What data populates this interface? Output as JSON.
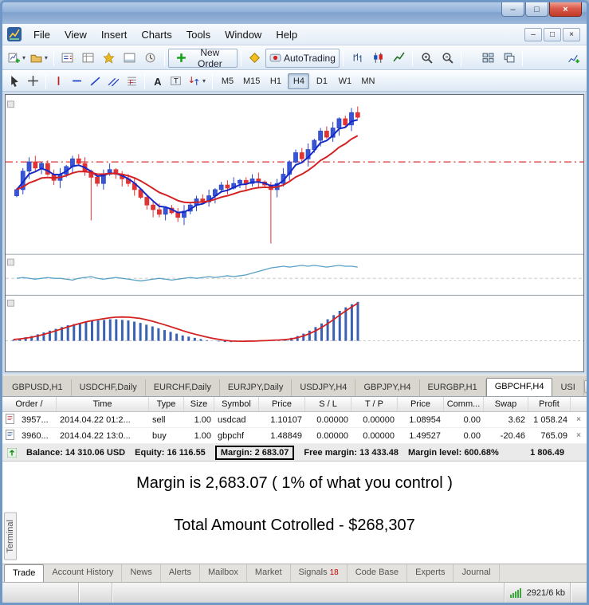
{
  "window": {
    "title": ""
  },
  "menu": {
    "items": [
      "File",
      "View",
      "Insert",
      "Charts",
      "Tools",
      "Window",
      "Help"
    ]
  },
  "toolbar": {
    "new_order_label": "New Order",
    "autotrading_label": "AutoTrading",
    "row1_groups": [
      [
        "new-chart",
        "profiles"
      ],
      [
        "market-watch",
        "data-window",
        "navigator",
        "terminal-panel",
        "strategy-tester"
      ],
      [
        "new-order"
      ],
      [
        "metaeditor",
        "autotrading"
      ],
      [
        "bar-chart",
        "candlestick-chart",
        "line-chart"
      ],
      [
        "zoom-in",
        "zoom-out"
      ],
      [
        "arrange-windows",
        "cascade-windows"
      ],
      [
        "indicators"
      ]
    ],
    "row2_groups": [
      [
        "cursor",
        "crosshair"
      ],
      [
        "vertical-line",
        "horizontal-line",
        "trendline",
        "channel",
        "fibonacci"
      ],
      [
        "text",
        "label",
        "shapes"
      ]
    ]
  },
  "timeframes": {
    "items": [
      "M5",
      "M15",
      "H1",
      "H4",
      "D1",
      "W1",
      "MN"
    ],
    "active": "H4"
  },
  "chart_tabs": {
    "items": [
      "GBPUSD,H1",
      "USDCHF,Daily",
      "EURCHF,Daily",
      "EURJPY,Daily",
      "USDJPY,H4",
      "GBPJPY,H4",
      "EURGBP,H1",
      "GBPCHF,H4",
      "USI"
    ],
    "active": "GBPCHF,H4"
  },
  "terminal": {
    "columns": [
      "Order /",
      "Time",
      "Type",
      "Size",
      "Symbol",
      "Price",
      "S / L",
      "T / P",
      "Price",
      "Comm...",
      "Swap",
      "Profit"
    ],
    "orders": [
      {
        "order": "3957...",
        "time": "2014.04.22 01:2...",
        "type": "sell",
        "size": "1.00",
        "symbol": "usdcad",
        "price": "1.10107",
        "sl": "0.00000",
        "tp": "0.00000",
        "price2": "1.08954",
        "commission": "0.00",
        "swap": "3.62",
        "profit": "1 058.24"
      },
      {
        "order": "3960...",
        "time": "2014.04.22 13:0...",
        "type": "buy",
        "size": "1.00",
        "symbol": "gbpchf",
        "price": "1.48849",
        "sl": "0.00000",
        "tp": "0.00000",
        "price2": "1.49527",
        "commission": "0.00",
        "swap": "-20.46",
        "profit": "765.09"
      }
    ],
    "balance_row": {
      "balance": "Balance: 14 310.06 USD",
      "equity": "Equity: 16 116.55",
      "margin": "Margin: 2 683.07",
      "free_margin": "Free margin: 13 433.48",
      "margin_level": "Margin level: 600.68%",
      "total_profit": "1 806.49"
    },
    "vertical_label": "Terminal"
  },
  "annotations": {
    "line1": "Margin is 2,683.07   ( 1% of what you control )",
    "line2": "Total Amount Cotrolled - $268,307"
  },
  "bottom_tabs": {
    "items": [
      "Trade",
      "Account History",
      "News",
      "Alerts",
      "Mailbox",
      "Market",
      "Signals",
      "Code Base",
      "Experts",
      "Journal"
    ],
    "active": "Trade",
    "signals_badge": "18"
  },
  "status_bar": {
    "traffic_text": "2921/6 kb"
  },
  "chart_data": {
    "type": "candlestick+indicators",
    "symbol": "GBPCHF,H4",
    "price": {
      "closes": [
        40,
        52,
        58,
        54,
        57,
        50,
        46,
        50,
        55,
        60,
        57,
        52,
        48,
        44,
        50,
        53,
        50,
        47,
        44,
        40,
        35,
        30,
        27,
        24,
        28,
        25,
        22,
        26,
        30,
        34,
        32,
        36,
        40,
        43,
        41,
        44,
        46,
        44,
        47,
        45,
        43,
        40,
        44,
        50,
        58,
        64,
        60,
        66,
        72,
        78,
        74,
        80,
        86,
        82,
        90,
        87
      ],
      "spikes": {
        "12": 20,
        "41": 5
      },
      "dash_line_level": 58,
      "ma_fast_color": "#1428c8",
      "ma_slow_color": "#d42020"
    },
    "mid": {
      "values": [
        50,
        51,
        50,
        49,
        50,
        51,
        50,
        50,
        49,
        48,
        50,
        51,
        52,
        50,
        49,
        50,
        51,
        50,
        49,
        48,
        47,
        48,
        49,
        50,
        49,
        48,
        49,
        50,
        51,
        50,
        51,
        52,
        51,
        52,
        53,
        52,
        53,
        54,
        56,
        58,
        60,
        62,
        63,
        64,
        63,
        64,
        65,
        64,
        65,
        64,
        63,
        64,
        65,
        64,
        64,
        63
      ],
      "line_color": "#58a0c8"
    },
    "osc": {
      "values": [
        2,
        4,
        6,
        8,
        11,
        14,
        17,
        20,
        23,
        26,
        28,
        30,
        32,
        33,
        34,
        35,
        36,
        36,
        35,
        34,
        32,
        30,
        27,
        24,
        21,
        18,
        15,
        12,
        9,
        7,
        5,
        3,
        1,
        0,
        -1,
        -2,
        -2,
        -1,
        -1,
        0,
        0,
        1,
        1,
        2,
        2,
        3,
        5,
        8,
        12,
        17,
        23,
        29,
        36,
        43,
        50,
        56,
        61,
        65
      ],
      "bar_color": "#3a62b0",
      "signal_color": "#d42020"
    }
  }
}
